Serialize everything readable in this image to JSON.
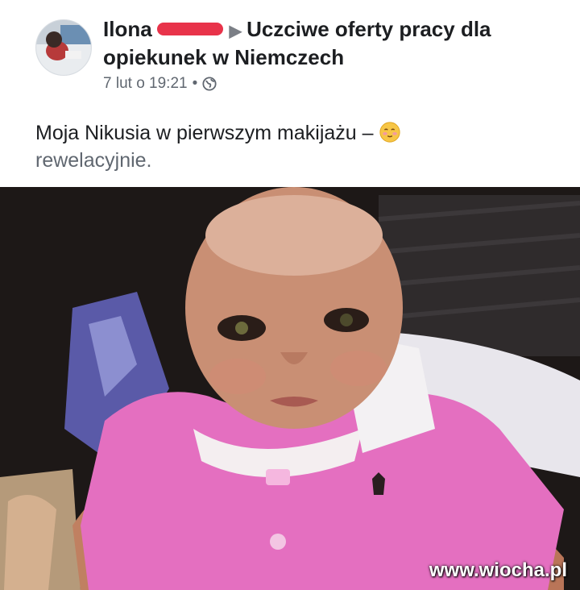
{
  "post": {
    "author": "Ilona",
    "group": "Uczciwe oferty pracy dla opiekunek w Niemczech",
    "timestamp": "7 lut o 19:21",
    "separator": "•",
    "privacy_icon": "globe-icon",
    "text_main": "Moja Nikusia w pierwszym makijażu –",
    "text_continuation": "rewelacyjnie.",
    "emoji": "blushing-face-emoji"
  },
  "watermark": "www.wiocha.pl",
  "colors": {
    "redaction": "#e8334a",
    "text_primary": "#1c1e21",
    "text_secondary": "#606770",
    "shirt_pink": "#e46fc0"
  }
}
